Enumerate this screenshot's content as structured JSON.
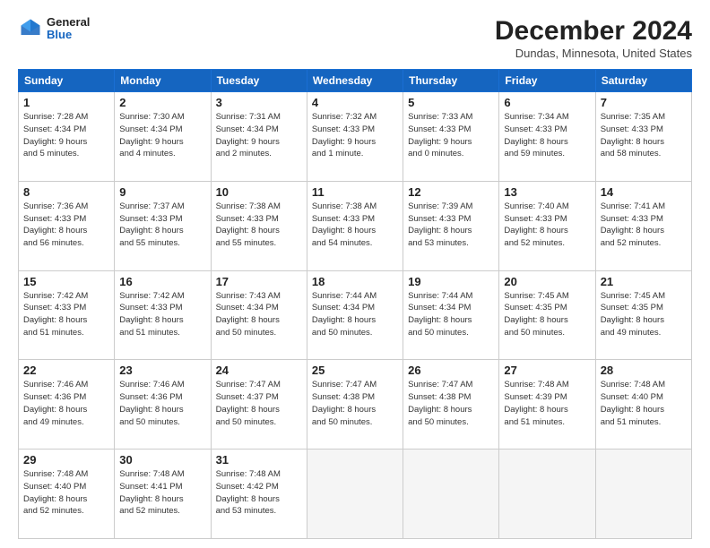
{
  "header": {
    "logo_general": "General",
    "logo_blue": "Blue",
    "title": "December 2024",
    "location": "Dundas, Minnesota, United States"
  },
  "days_of_week": [
    "Sunday",
    "Monday",
    "Tuesday",
    "Wednesday",
    "Thursday",
    "Friday",
    "Saturday"
  ],
  "weeks": [
    [
      {
        "day": "1",
        "info": "Sunrise: 7:28 AM\nSunset: 4:34 PM\nDaylight: 9 hours\nand 5 minutes."
      },
      {
        "day": "2",
        "info": "Sunrise: 7:30 AM\nSunset: 4:34 PM\nDaylight: 9 hours\nand 4 minutes."
      },
      {
        "day": "3",
        "info": "Sunrise: 7:31 AM\nSunset: 4:34 PM\nDaylight: 9 hours\nand 2 minutes."
      },
      {
        "day": "4",
        "info": "Sunrise: 7:32 AM\nSunset: 4:33 PM\nDaylight: 9 hours\nand 1 minute."
      },
      {
        "day": "5",
        "info": "Sunrise: 7:33 AM\nSunset: 4:33 PM\nDaylight: 9 hours\nand 0 minutes."
      },
      {
        "day": "6",
        "info": "Sunrise: 7:34 AM\nSunset: 4:33 PM\nDaylight: 8 hours\nand 59 minutes."
      },
      {
        "day": "7",
        "info": "Sunrise: 7:35 AM\nSunset: 4:33 PM\nDaylight: 8 hours\nand 58 minutes."
      }
    ],
    [
      {
        "day": "8",
        "info": "Sunrise: 7:36 AM\nSunset: 4:33 PM\nDaylight: 8 hours\nand 56 minutes."
      },
      {
        "day": "9",
        "info": "Sunrise: 7:37 AM\nSunset: 4:33 PM\nDaylight: 8 hours\nand 55 minutes."
      },
      {
        "day": "10",
        "info": "Sunrise: 7:38 AM\nSunset: 4:33 PM\nDaylight: 8 hours\nand 55 minutes."
      },
      {
        "day": "11",
        "info": "Sunrise: 7:38 AM\nSunset: 4:33 PM\nDaylight: 8 hours\nand 54 minutes."
      },
      {
        "day": "12",
        "info": "Sunrise: 7:39 AM\nSunset: 4:33 PM\nDaylight: 8 hours\nand 53 minutes."
      },
      {
        "day": "13",
        "info": "Sunrise: 7:40 AM\nSunset: 4:33 PM\nDaylight: 8 hours\nand 52 minutes."
      },
      {
        "day": "14",
        "info": "Sunrise: 7:41 AM\nSunset: 4:33 PM\nDaylight: 8 hours\nand 52 minutes."
      }
    ],
    [
      {
        "day": "15",
        "info": "Sunrise: 7:42 AM\nSunset: 4:33 PM\nDaylight: 8 hours\nand 51 minutes."
      },
      {
        "day": "16",
        "info": "Sunrise: 7:42 AM\nSunset: 4:33 PM\nDaylight: 8 hours\nand 51 minutes."
      },
      {
        "day": "17",
        "info": "Sunrise: 7:43 AM\nSunset: 4:34 PM\nDaylight: 8 hours\nand 50 minutes."
      },
      {
        "day": "18",
        "info": "Sunrise: 7:44 AM\nSunset: 4:34 PM\nDaylight: 8 hours\nand 50 minutes."
      },
      {
        "day": "19",
        "info": "Sunrise: 7:44 AM\nSunset: 4:34 PM\nDaylight: 8 hours\nand 50 minutes."
      },
      {
        "day": "20",
        "info": "Sunrise: 7:45 AM\nSunset: 4:35 PM\nDaylight: 8 hours\nand 50 minutes."
      },
      {
        "day": "21",
        "info": "Sunrise: 7:45 AM\nSunset: 4:35 PM\nDaylight: 8 hours\nand 49 minutes."
      }
    ],
    [
      {
        "day": "22",
        "info": "Sunrise: 7:46 AM\nSunset: 4:36 PM\nDaylight: 8 hours\nand 49 minutes."
      },
      {
        "day": "23",
        "info": "Sunrise: 7:46 AM\nSunset: 4:36 PM\nDaylight: 8 hours\nand 50 minutes."
      },
      {
        "day": "24",
        "info": "Sunrise: 7:47 AM\nSunset: 4:37 PM\nDaylight: 8 hours\nand 50 minutes."
      },
      {
        "day": "25",
        "info": "Sunrise: 7:47 AM\nSunset: 4:38 PM\nDaylight: 8 hours\nand 50 minutes."
      },
      {
        "day": "26",
        "info": "Sunrise: 7:47 AM\nSunset: 4:38 PM\nDaylight: 8 hours\nand 50 minutes."
      },
      {
        "day": "27",
        "info": "Sunrise: 7:48 AM\nSunset: 4:39 PM\nDaylight: 8 hours\nand 51 minutes."
      },
      {
        "day": "28",
        "info": "Sunrise: 7:48 AM\nSunset: 4:40 PM\nDaylight: 8 hours\nand 51 minutes."
      }
    ],
    [
      {
        "day": "29",
        "info": "Sunrise: 7:48 AM\nSunset: 4:40 PM\nDaylight: 8 hours\nand 52 minutes."
      },
      {
        "day": "30",
        "info": "Sunrise: 7:48 AM\nSunset: 4:41 PM\nDaylight: 8 hours\nand 52 minutes."
      },
      {
        "day": "31",
        "info": "Sunrise: 7:48 AM\nSunset: 4:42 PM\nDaylight: 8 hours\nand 53 minutes."
      },
      {
        "day": "",
        "info": ""
      },
      {
        "day": "",
        "info": ""
      },
      {
        "day": "",
        "info": ""
      },
      {
        "day": "",
        "info": ""
      }
    ]
  ]
}
